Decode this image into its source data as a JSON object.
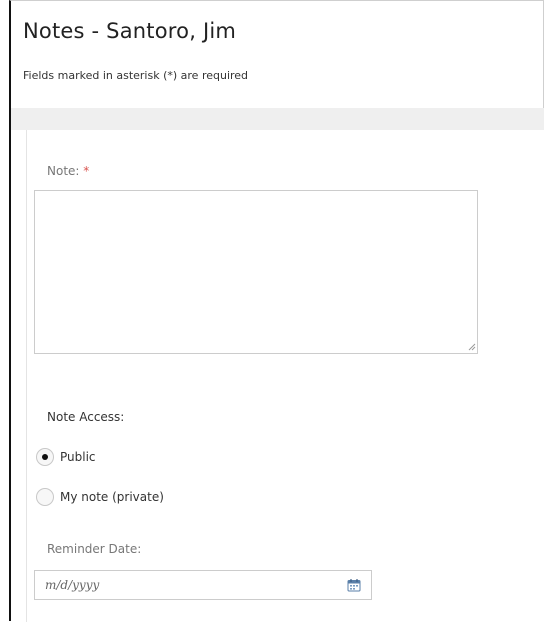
{
  "page": {
    "title": "Notes - Santoro, Jim",
    "required_note": "Fields marked in asterisk (*) are required"
  },
  "form": {
    "note_label": "Note:",
    "required_marker": "*",
    "note_value": "",
    "access_label": "Note Access:",
    "access_options": [
      {
        "label": "Public",
        "checked": true
      },
      {
        "label": "My note (private)",
        "checked": false
      }
    ],
    "reminder_label": "Reminder Date:",
    "reminder_placeholder": "m/d/yyyy",
    "reminder_value": ""
  },
  "icons": {
    "calendar": "calendar-icon",
    "resize": "resize-grip-icon"
  },
  "colors": {
    "required": "#d9534f",
    "band": "#efefef",
    "border": "#cccccc"
  }
}
